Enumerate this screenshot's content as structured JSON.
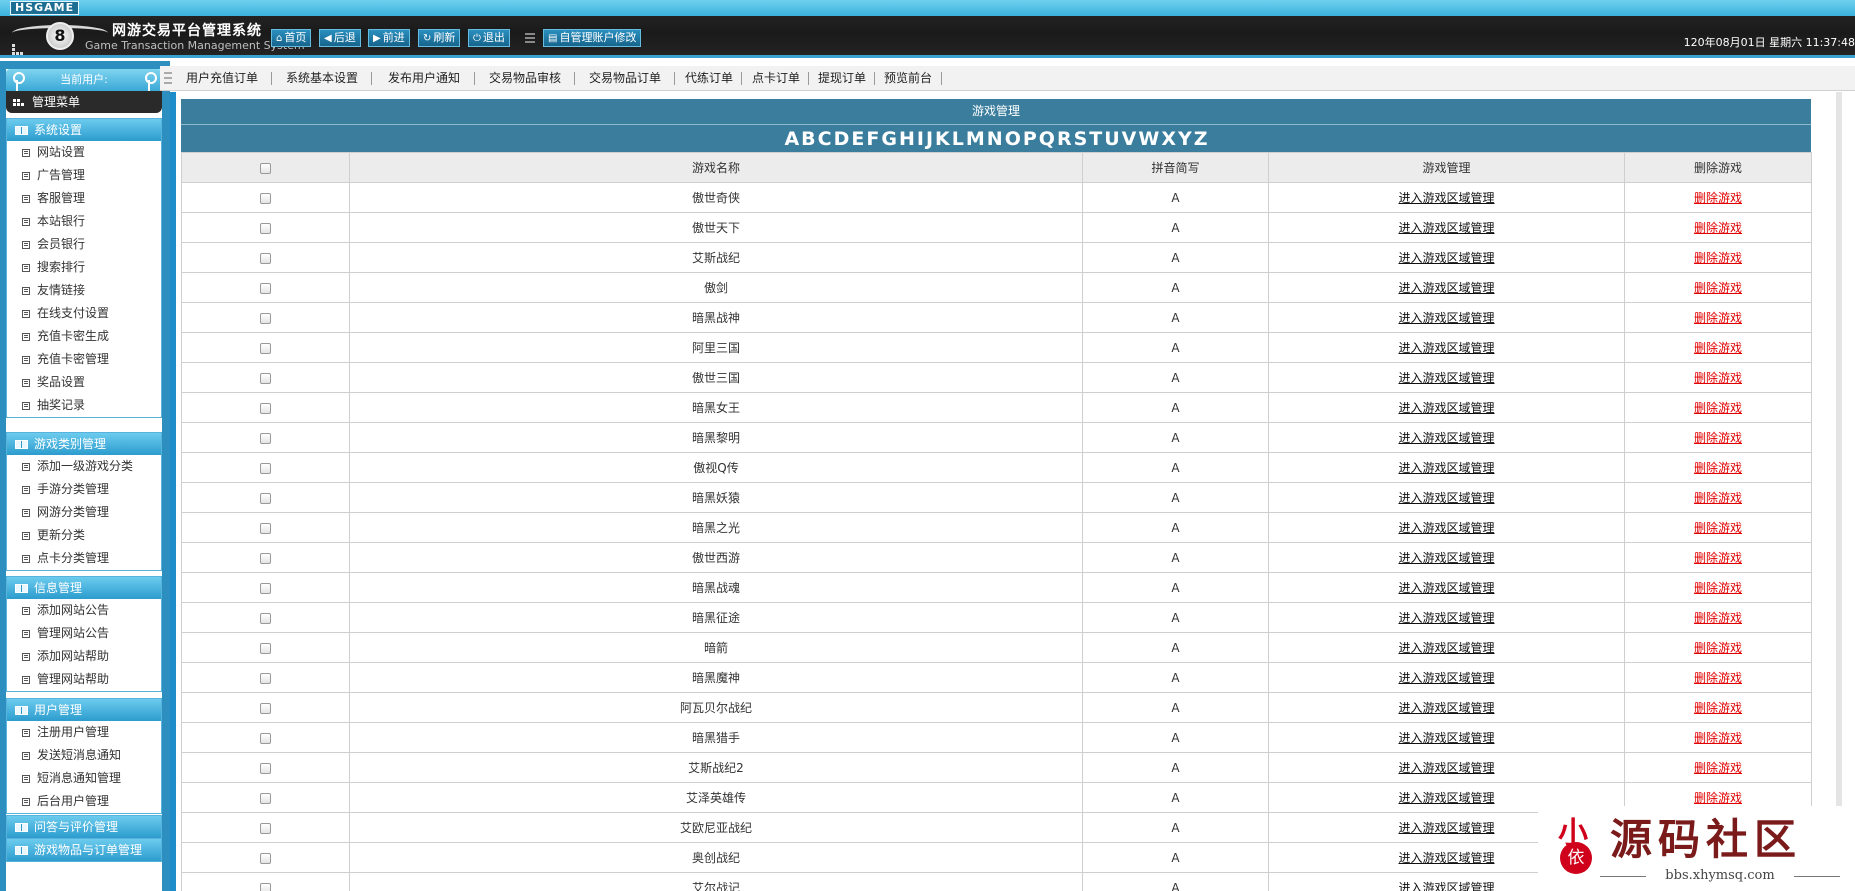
{
  "header": {
    "brand_tag": "HSGAME",
    "logo_mark": "8",
    "title": "网游交易平台管理系统",
    "subtitle": "Game Transaction Management System",
    "buttons": [
      {
        "label": "首页",
        "icon": "home-icon",
        "glyph": "⌂"
      },
      {
        "label": "后退",
        "icon": "back-arrow-icon",
        "glyph": "◀"
      },
      {
        "label": "前进",
        "icon": "forward-arrow-icon",
        "glyph": "▶"
      },
      {
        "label": "刷新",
        "icon": "refresh-icon",
        "glyph": "↻"
      },
      {
        "label": "退出",
        "icon": "power-icon",
        "glyph": "⏻"
      }
    ],
    "account_button": "自管理账户修改",
    "datetime": "120年08月01日 星期六 11:37:48"
  },
  "sidebar": {
    "current_user_label": "当前用户:",
    "menu_title": "管理菜单",
    "groups": [
      {
        "title": "系统设置",
        "items": [
          "网站设置",
          "广告管理",
          "客服管理",
          "本站银行",
          "会员银行",
          "搜索排行",
          "友情链接",
          "在线支付设置",
          "充值卡密生成",
          "充值卡密管理",
          "奖品设置",
          "抽奖记录"
        ]
      },
      {
        "title": "游戏类别管理",
        "items": [
          "添加一级游戏分类",
          "手游分类管理",
          "网游分类管理",
          "更新分类",
          "点卡分类管理"
        ]
      },
      {
        "title": "信息管理",
        "items": [
          "添加网站公告",
          "管理网站公告",
          "添加网站帮助",
          "管理网站帮助"
        ]
      },
      {
        "title": "用户管理",
        "items": [
          "注册用户管理",
          "发送短消息通知",
          "短消息通知管理",
          "后台用户管理"
        ]
      },
      {
        "title": "问答与评价管理",
        "items": []
      },
      {
        "title": "游戏物品与订单管理",
        "items": []
      }
    ]
  },
  "tabs": [
    "用户充值订单",
    "系统基本设置",
    "发布用户通知",
    "交易物品审核",
    "交易物品订单",
    "代练订单",
    "点卡订单",
    "提现订单",
    "预览前台"
  ],
  "panel": {
    "title": "游戏管理",
    "alphabet": [
      "A",
      "B",
      "C",
      "D",
      "E",
      "F",
      "G",
      "H",
      "I",
      "J",
      "K",
      "L",
      "M",
      "N",
      "O",
      "P",
      "Q",
      "R",
      "S",
      "T",
      "U",
      "V",
      "W",
      "X",
      "Y",
      "Z"
    ],
    "columns": [
      "",
      "游戏名称",
      "拼音简写",
      "游戏管理",
      "删除游戏"
    ],
    "manage_link": "进入游戏区域管理",
    "delete_link": "删除游戏",
    "rows": [
      {
        "name": "傲世奇侠",
        "pinyin": "A"
      },
      {
        "name": "傲世天下",
        "pinyin": "A"
      },
      {
        "name": "艾斯战纪",
        "pinyin": "A"
      },
      {
        "name": "傲剑",
        "pinyin": "A"
      },
      {
        "name": "暗黑战神",
        "pinyin": "A"
      },
      {
        "name": "阿里三国",
        "pinyin": "A"
      },
      {
        "name": "傲世三国",
        "pinyin": "A"
      },
      {
        "name": "暗黑女王",
        "pinyin": "A"
      },
      {
        "name": "暗黑黎明",
        "pinyin": "A"
      },
      {
        "name": "傲视Q传",
        "pinyin": "A"
      },
      {
        "name": "暗黑妖猿",
        "pinyin": "A"
      },
      {
        "name": "暗黑之光",
        "pinyin": "A"
      },
      {
        "name": "傲世西游",
        "pinyin": "A"
      },
      {
        "name": "暗黑战魂",
        "pinyin": "A"
      },
      {
        "name": "暗黑征途",
        "pinyin": "A"
      },
      {
        "name": "暗箭",
        "pinyin": "A"
      },
      {
        "name": "暗黑魔神",
        "pinyin": "A"
      },
      {
        "name": "阿瓦贝尔战纪",
        "pinyin": "A"
      },
      {
        "name": "暗黑猎手",
        "pinyin": "A"
      },
      {
        "name": "艾斯战纪2",
        "pinyin": "A"
      },
      {
        "name": "艾泽英雄传",
        "pinyin": "A"
      },
      {
        "name": "艾欧尼亚战纪",
        "pinyin": "A"
      },
      {
        "name": "奥创战纪",
        "pinyin": "A"
      },
      {
        "name": "艾尔战记",
        "pinyin": "A"
      }
    ]
  },
  "watermark": {
    "seal_top": "小",
    "seal_bottom": "依",
    "text": "源码社区",
    "url": "bbs.xhymsq.com"
  },
  "colors": {
    "accent": "#2c9cce",
    "header_bg": "#1f1f1f",
    "panel_header": "#3b7d9d",
    "delete_link": "#e00000"
  }
}
